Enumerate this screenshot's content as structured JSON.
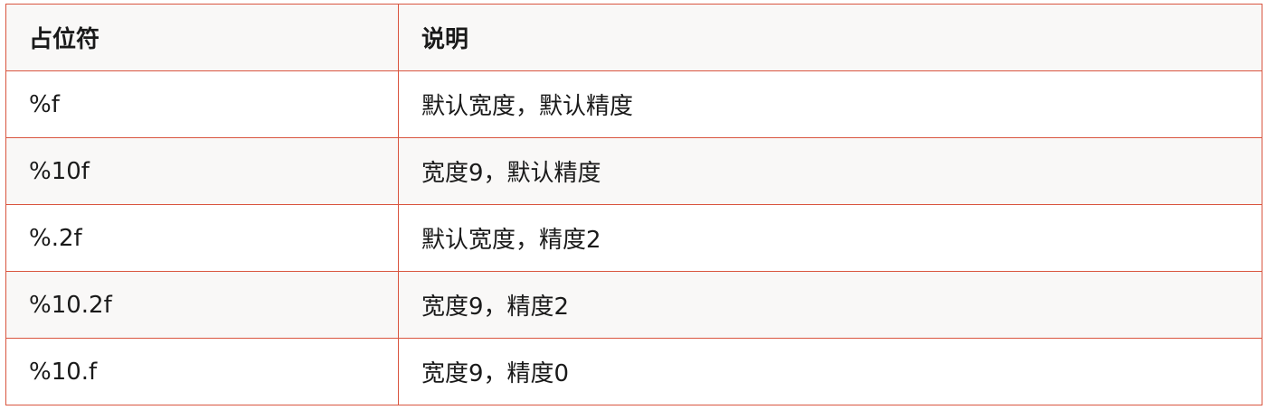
{
  "table": {
    "headers": [
      "占位符",
      "说明"
    ],
    "rows": [
      [
        "%f",
        "默认宽度，默认精度"
      ],
      [
        "%10f",
        "宽度9，默认精度"
      ],
      [
        "%.2f",
        "默认宽度，精度2"
      ],
      [
        "%10.2f",
        "宽度9，精度2"
      ],
      [
        "%10.f",
        "宽度9，精度0"
      ]
    ]
  },
  "colors": {
    "border": "#d9553f",
    "header_bg": "#f9f8f7",
    "stripe_bg": "#f9f8f7",
    "row_bg": "#ffffff",
    "text": "#1a1a1a"
  }
}
